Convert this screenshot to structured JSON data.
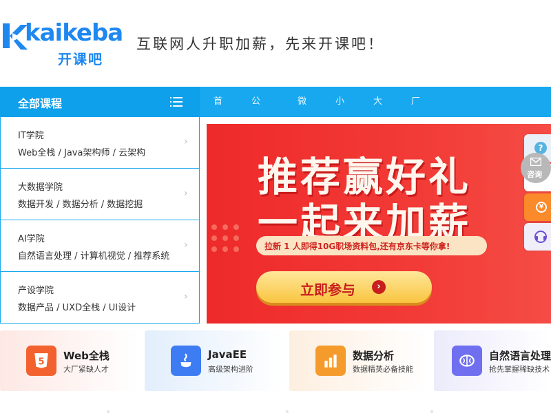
{
  "header": {
    "logo_text": "kaikeba",
    "logo_cn": "开课吧",
    "slogan": "互联网人升职加薪，先来开课吧！"
  },
  "navbar": {
    "all_courses_label": "全部课程",
    "links": [
      "首页",
      "公开课",
      "微课",
      "小课",
      "大课",
      "厂课"
    ]
  },
  "sidebar": {
    "items": [
      {
        "title": "IT学院",
        "sub": "Web全栈 / Java架构师 / 云架构"
      },
      {
        "title": "大数据学院",
        "sub": "数据开发 / 数据分析 / 数据挖掘"
      },
      {
        "title": "AI学院",
        "sub": "自然语言处理 / 计算机视觉 / 推荐系统"
      },
      {
        "title": "产设学院",
        "sub": "数据产品 / UXD全栈 / UI设计"
      }
    ],
    "arrow": "›"
  },
  "banner": {
    "headline1": "推荐赢好礼",
    "headline2": "一起来加薪",
    "pill_text": "拉新 1 人即得10G职场资料包,还有京东卡等你拿!",
    "button_label": "立即参与",
    "button_icon": "›"
  },
  "tools": {
    "help_icon": "?",
    "consult_label": "咨询",
    "yuan_icon": "¥"
  },
  "cards": [
    {
      "title": "Web全栈",
      "sub": "大厂紧缺人才",
      "icon": "html5-icon",
      "icon_glyph": "5",
      "bg": "#fde8e4",
      "icon_color": "#f2612e"
    },
    {
      "title": "JavaEE",
      "sub": "高级架构进阶",
      "icon": "java-icon",
      "icon_glyph": "☕",
      "bg": "#e2eefc",
      "icon_color": "#3d7cf2"
    },
    {
      "title": "数据分析",
      "sub": "数据精英必备技能",
      "icon": "chart-icon",
      "icon_glyph": "▮",
      "bg": "#fdefe0",
      "icon_color": "#f59b2c"
    },
    {
      "title": "自然语言处理",
      "sub": "抢先掌握稀缺技术",
      "icon": "brain-icon",
      "icon_glyph": "◉",
      "bg": "#ecebfb",
      "icon_color": "#6f6ff0"
    }
  ],
  "colors": {
    "brand_blue": "#1e88f0",
    "nav_blue": "#17a8f0",
    "banner_red": "#ee2a2a"
  }
}
